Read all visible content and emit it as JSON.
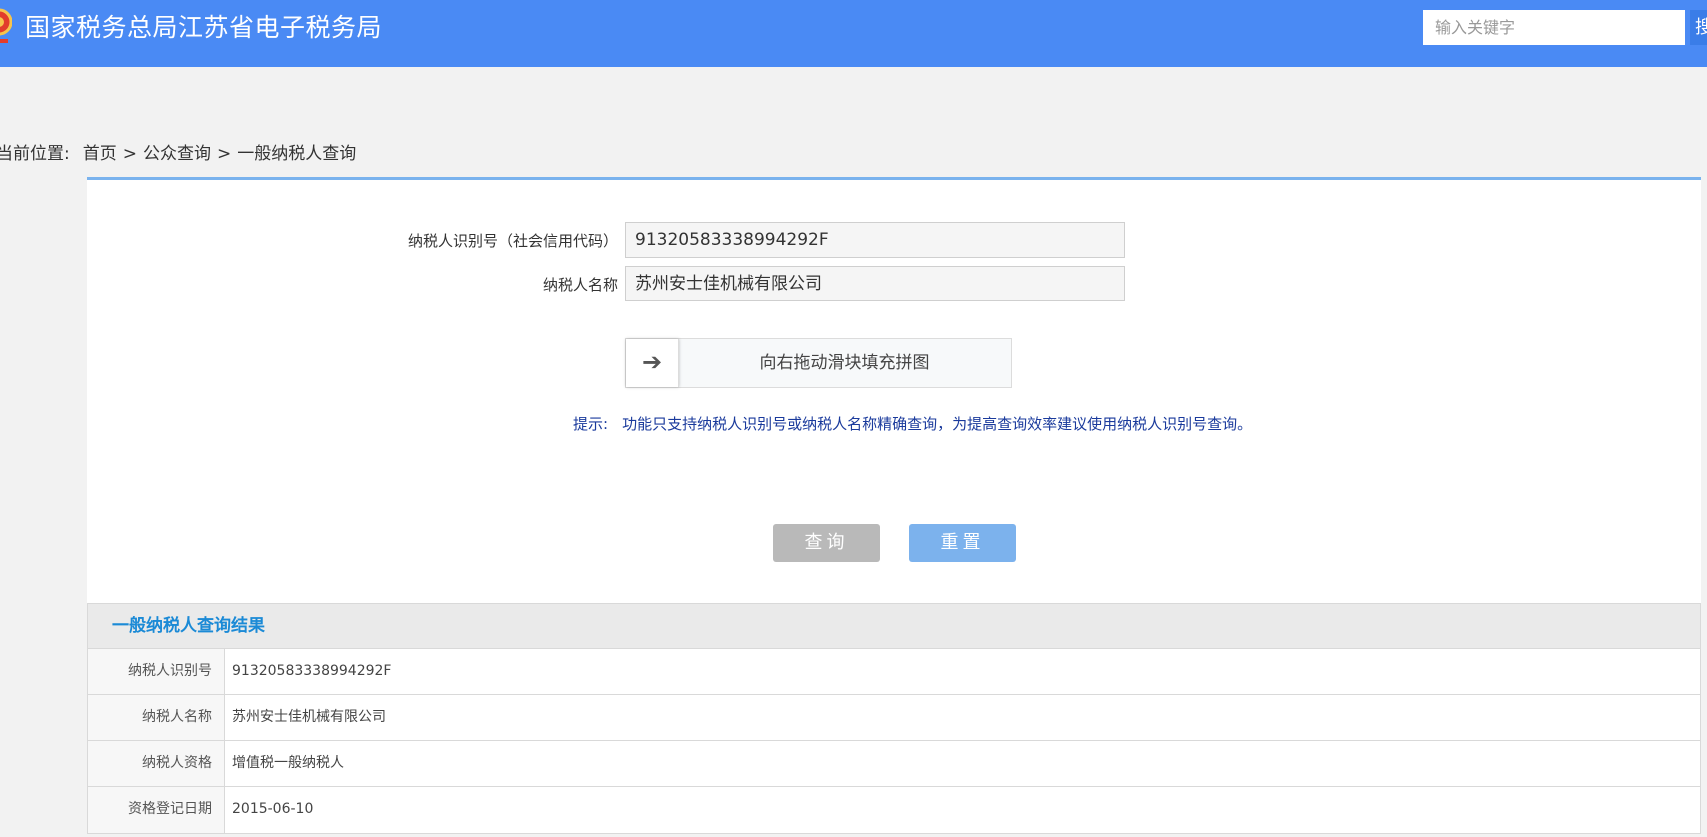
{
  "header": {
    "title": "国家税务总局江苏省电子税务局",
    "search_placeholder": "输入关键字",
    "search_button_label": "搜"
  },
  "breadcrumb": {
    "prefix": "当前位置:",
    "items": [
      "首页",
      "公众查询",
      "一般纳税人查询"
    ],
    "separator": ">"
  },
  "form": {
    "taxpayer_id_label": "纳税人识别号（社会信用代码）",
    "taxpayer_id_value": "91320583338994292F",
    "taxpayer_name_label": "纳税人名称",
    "taxpayer_name_value": "苏州安士佳机械有限公司",
    "slider_text": "向右拖动滑块填充拼图",
    "hint_label": "提示:",
    "hint_text": "功能只支持纳税人识别号或纳税人名称精确查询，为提高查询效率建议使用纳税人识别号查询。",
    "query_button": "查询",
    "reset_button": "重置"
  },
  "results": {
    "title": "一般纳税人查询结果",
    "rows": [
      {
        "label": "纳税人识别号",
        "value": "91320583338994292F"
      },
      {
        "label": "纳税人名称",
        "value": "苏州安士佳机械有限公司"
      },
      {
        "label": "纳税人资格",
        "value": "增值税一般纳税人"
      },
      {
        "label": "资格登记日期",
        "value": "2015-06-10"
      }
    ]
  },
  "colors": {
    "header_bg": "#4a8af4",
    "accent_line": "#7ab3ee",
    "results_title": "#1b8ad6",
    "query_button_bg": "#b9b9b9",
    "reset_button_bg": "#7cb2ed"
  }
}
